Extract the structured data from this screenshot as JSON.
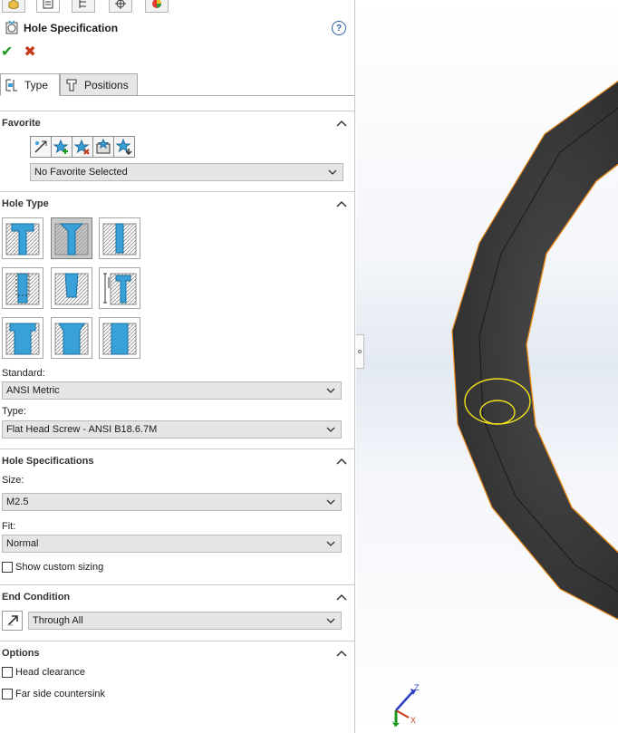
{
  "pm": {
    "title": "Hole Specification",
    "help_glyph": "?",
    "ok_glyph": "✔",
    "cancel_glyph": "✖",
    "tabs": [
      "part-icon",
      "property-manager-icon",
      "configuration-icon",
      "dimxpert-icon",
      "appearance-icon"
    ],
    "subtabs": [
      {
        "label": "Type",
        "icon": "hole-type-icon"
      },
      {
        "label": "Positions",
        "icon": "hole-position-icon"
      }
    ]
  },
  "favorite": {
    "title": "Favorite",
    "toolbar_icons": [
      "apply-defaults-icon",
      "add-favorite-icon",
      "delete-favorite-icon",
      "save-favorite-icon",
      "load-favorite-icon"
    ],
    "selected": "No Favorite Selected"
  },
  "hole_type": {
    "title": "Hole Type",
    "buttons": [
      "counterbore",
      "countersink",
      "hole",
      "straight-tap",
      "tapered-tap",
      "legacy-hole",
      "counterbore-slot",
      "countersink-slot",
      "slot"
    ],
    "selected_index": 1,
    "standard_label": "Standard:",
    "standard_value": "ANSI Metric",
    "type_label": "Type:",
    "type_value": "Flat Head Screw - ANSI B18.6.7M"
  },
  "hole_specs": {
    "title": "Hole Specifications",
    "size_label": "Size:",
    "size_value": "M2.5",
    "fit_label": "Fit:",
    "fit_value": "Normal",
    "custom_sizing_label": "Show custom sizing"
  },
  "end_condition": {
    "title": "End Condition",
    "value": "Through All",
    "icon": "reverse-direction-icon"
  },
  "options": {
    "title": "Options",
    "head_clearance_label": "Head clearance",
    "far_side_label": "Far side countersink"
  },
  "triad": {
    "z": "Z",
    "x": "X",
    "y": "Y"
  },
  "colors": {
    "accent_blue": "#3aa0d8",
    "edge_orange": "#e98a1d",
    "preview_yellow": "#f0e21a",
    "part_gray": "#3a3a3a"
  }
}
